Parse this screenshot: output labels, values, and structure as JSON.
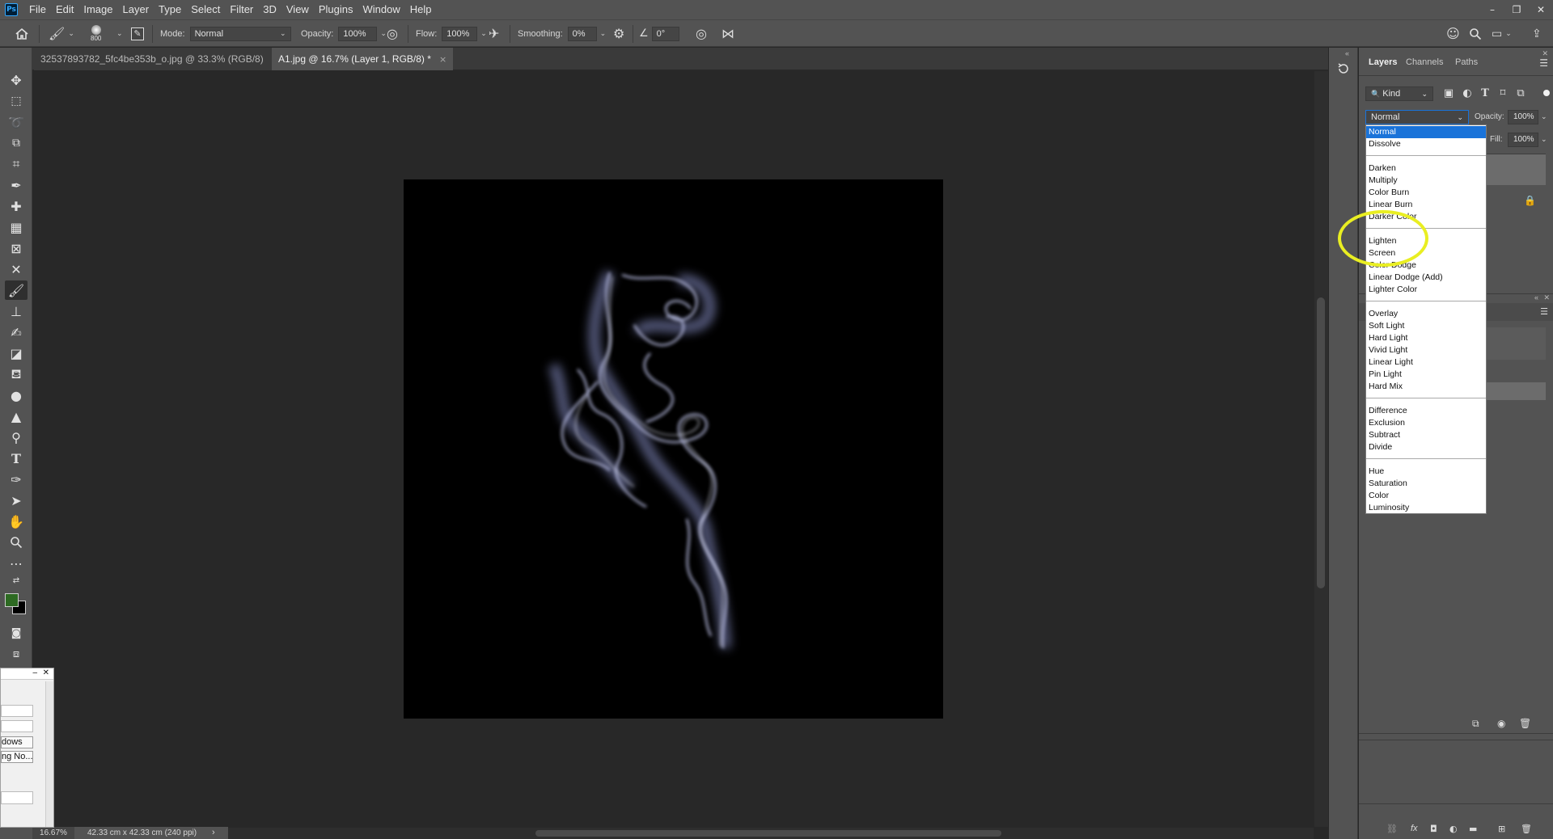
{
  "app": {
    "logo": "Ps"
  },
  "menu": [
    "File",
    "Edit",
    "Image",
    "Layer",
    "Type",
    "Select",
    "Filter",
    "3D",
    "View",
    "Plugins",
    "Window",
    "Help"
  ],
  "window_controls": {
    "minimize": "–",
    "restore": "❐",
    "close": "✕"
  },
  "options_bar": {
    "brush_size": "800",
    "mode_label": "Mode:",
    "mode_value": "Normal",
    "opacity_label": "Opacity:",
    "opacity_value": "100%",
    "flow_label": "Flow:",
    "flow_value": "100%",
    "smoothing_label": "Smoothing:",
    "smoothing_value": "0%",
    "angle_value": "0°"
  },
  "tabs": [
    {
      "label": "32537893782_5fc4be353b_o.jpg @ 33.3% (RGB/8)",
      "active": false
    },
    {
      "label": "A1.jpg @ 16.7% (Layer 1, RGB/8) *",
      "active": true
    }
  ],
  "tab_close": "×",
  "status": {
    "zoom": "16.67%",
    "dimensions": "42.33 cm x 42.33 cm (240 ppi)",
    "arrow": "›"
  },
  "float_dialog": {
    "minimize": "–",
    "close": "✕",
    "row1": "dows",
    "row2": "ng No..."
  },
  "layers_panel": {
    "tabs": [
      "Layers",
      "Channels",
      "Paths"
    ],
    "filter_kind": "Kind",
    "blend_mode": "Normal",
    "opacity_label": "Opacity:",
    "opacity_value": "100%",
    "fill_label": "Fill:",
    "fill_value": "100%"
  },
  "blend_modes": {
    "selected": "Normal",
    "group1": [
      "Normal",
      "Dissolve"
    ],
    "group2": [
      "Darken",
      "Multiply",
      "Color Burn",
      "Linear Burn",
      "Darker Color"
    ],
    "group3": [
      "Lighten",
      "Screen",
      "Color Dodge",
      "Linear Dodge (Add)",
      "Lighter Color"
    ],
    "group4": [
      "Overlay",
      "Soft Light",
      "Hard Light",
      "Vivid Light",
      "Linear Light",
      "Pin Light",
      "Hard Mix"
    ],
    "group5": [
      "Difference",
      "Exclusion",
      "Subtract",
      "Divide"
    ],
    "group6": [
      "Hue",
      "Saturation",
      "Color",
      "Luminosity"
    ]
  },
  "colors": {
    "foreground": "#2d6a22",
    "background": "#000000",
    "highlight": "#e9ee22",
    "selection": "#1a73d9"
  }
}
